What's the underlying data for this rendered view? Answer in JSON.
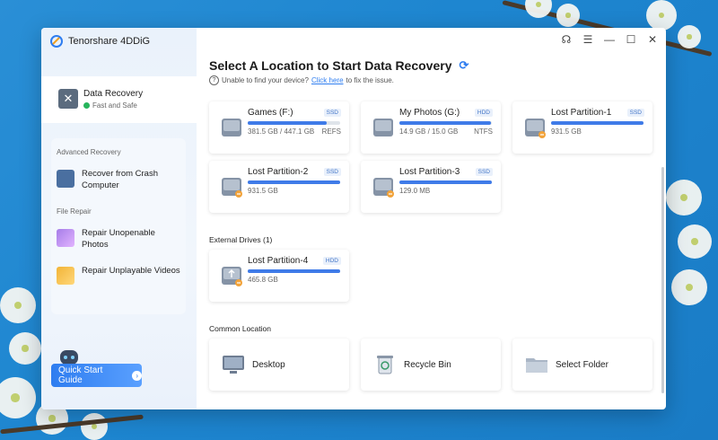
{
  "app": {
    "name": "Tenorshare 4DDiG"
  },
  "titlebar": {
    "icons": [
      "headset-icon",
      "menu-icon",
      "minimize-icon",
      "maximize-icon",
      "close-icon"
    ]
  },
  "sidebar": {
    "active": {
      "title": "Data Recovery",
      "subtitle": "Fast and Safe"
    },
    "advanced_label": "Advanced Recovery",
    "crash_label": "Recover from Crash Computer",
    "file_repair_label": "File Repair",
    "repair_photos_label": "Repair Unopenable Photos",
    "repair_videos_label": "Repair Unplayable Videos",
    "quick_start": "Quick Start Guide"
  },
  "main": {
    "heading": "Select A Location to Start Data Recovery",
    "help_prefix": "Unable to find your device?",
    "help_link": "Click here",
    "help_suffix": "to fix the issue.",
    "drives": [
      {
        "name": "Games (F:)",
        "type": "SSD",
        "size": "381.5 GB / 447.1 GB",
        "fs": "REFS",
        "used": 0.85
      },
      {
        "name": "My Photos (G:)",
        "type": "HDD",
        "size": "14.9 GB / 15.0 GB",
        "fs": "NTFS",
        "used": 0.99
      },
      {
        "name": "Lost Partition-1",
        "type": "SSD",
        "size": "931.5 GB",
        "fs": "",
        "used": 1.0
      },
      {
        "name": "Lost Partition-2",
        "type": "SSD",
        "size": "931.5 GB",
        "fs": "",
        "used": 1.0
      },
      {
        "name": "Lost Partition-3",
        "type": "SSD",
        "size": "129.0 MB",
        "fs": "",
        "used": 1.0
      }
    ],
    "external_label": "External Drives (1)",
    "external": [
      {
        "name": "Lost Partition-4",
        "type": "HDD",
        "size": "465.8 GB",
        "fs": "",
        "used": 1.0
      }
    ],
    "common_label": "Common Location",
    "common": [
      {
        "label": "Desktop",
        "icon": "desktop-icon"
      },
      {
        "label": "Recycle Bin",
        "icon": "recycle-bin-icon"
      },
      {
        "label": "Select Folder",
        "icon": "folder-icon"
      }
    ]
  },
  "colors": {
    "accent": "#2e7df0",
    "bar": "#3f7be8",
    "safe": "#27b45c",
    "background": "#1e86d0"
  }
}
